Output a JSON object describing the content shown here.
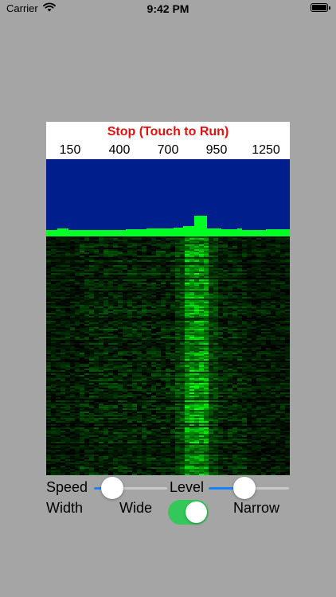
{
  "status_bar": {
    "carrier": "Carrier",
    "time": "9:42 PM",
    "battery_level": 1.0
  },
  "display": {
    "run_label": "Stop (Touch to Run)",
    "frequency_labels": [
      "150",
      "400",
      "700",
      "950",
      "1250"
    ],
    "colors": {
      "spectrum_bg": "#001e8c",
      "signal": "#00ff22",
      "run_label": "#e01010"
    }
  },
  "controls": {
    "speed_label": "Speed",
    "speed_value": 0.25,
    "level_label": "Level",
    "level_value": 0.45,
    "width_label": "Width",
    "wide_label": "Wide",
    "narrow_label": "Narrow",
    "narrow_on": true
  }
}
